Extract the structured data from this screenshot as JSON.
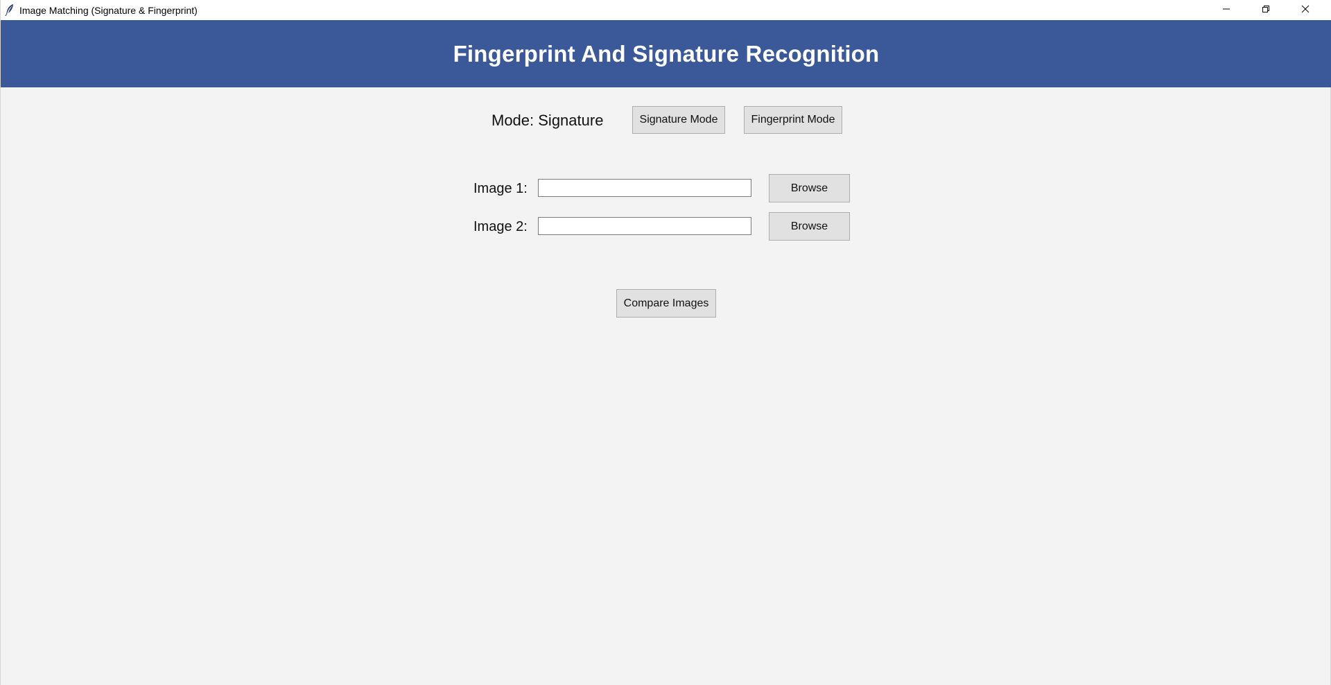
{
  "window": {
    "title": "Image Matching (Signature & Fingerprint)",
    "controls": {
      "minimize_icon": "minimize-icon",
      "restore_icon": "restore-icon",
      "close_icon": "close-icon"
    }
  },
  "header": {
    "title": "Fingerprint And Signature Recognition",
    "background": "#3b5998",
    "text_color": "#ffffff"
  },
  "mode": {
    "label": "Mode: Signature",
    "signature_button": "Signature Mode",
    "fingerprint_button": "Fingerprint Mode"
  },
  "inputs": {
    "image1": {
      "label": "Image 1:",
      "value": "",
      "browse_label": "Browse"
    },
    "image2": {
      "label": "Image 2:",
      "value": "",
      "browse_label": "Browse"
    }
  },
  "actions": {
    "compare_label": "Compare Images"
  },
  "colors": {
    "background": "#f3f3f3",
    "button_face": "#e1e1e1",
    "button_border": "#adadad"
  }
}
